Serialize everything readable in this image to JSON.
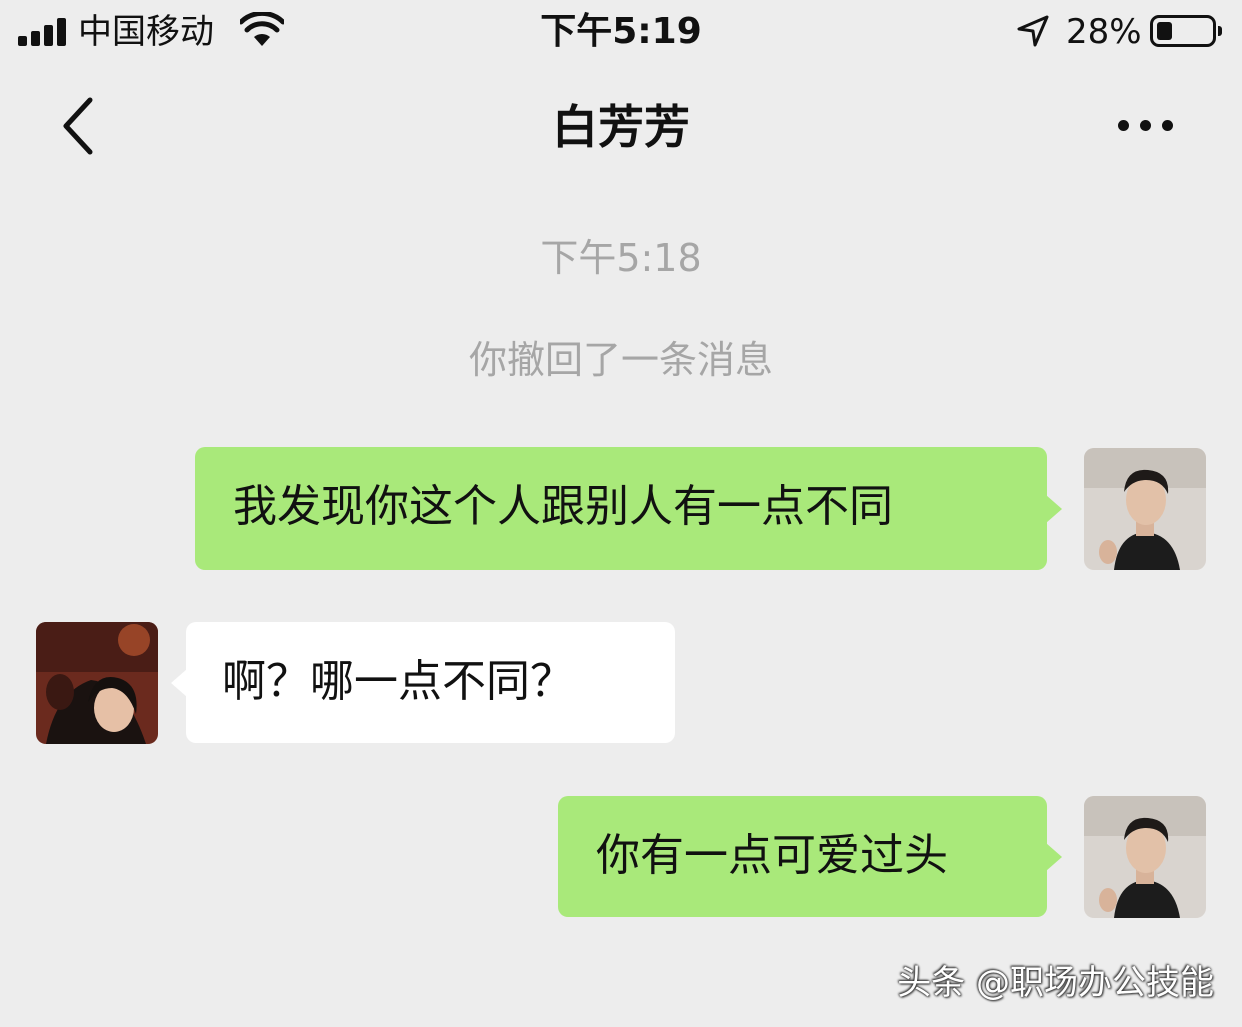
{
  "status_bar": {
    "carrier": "中国移动",
    "time": "下午5:19",
    "battery_percent": "28%",
    "battery_level": 0.28
  },
  "nav": {
    "title": "白芳芳",
    "back_icon": "chevron-left-icon",
    "more_icon": "ellipsis-icon"
  },
  "chat": {
    "timestamp": "下午5:18",
    "system_message": "你撤回了一条消息",
    "messages": [
      {
        "sender": "me",
        "text": "我发现你这个人跟别人有一点不同"
      },
      {
        "sender": "other",
        "text": "啊？哪一点不同？"
      },
      {
        "sender": "me",
        "text": "你有一点可爱过头"
      }
    ]
  },
  "watermark": "头条 @职场办公技能",
  "colors": {
    "background": "#ededed",
    "sent_bubble": "#a9e97a",
    "received_bubble": "#ffffff",
    "muted_text": "#a6a6a6"
  }
}
